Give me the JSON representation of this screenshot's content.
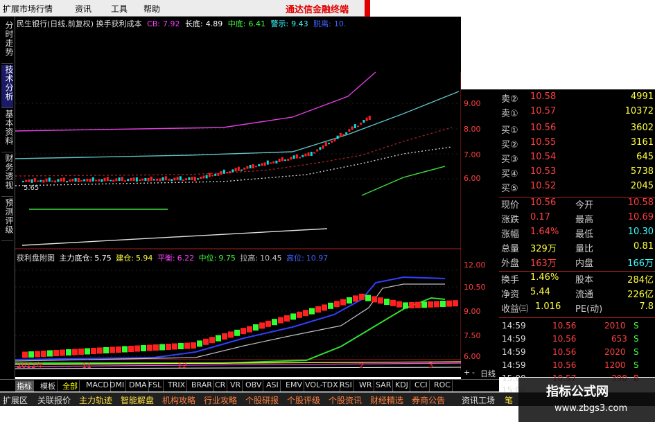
{
  "menubar": {
    "items": [
      "扩展市场行情",
      "资讯",
      "工具",
      "帮助"
    ],
    "brand": "通达信金融终端"
  },
  "left_tabs": [
    "分时走势",
    "技术分析",
    "基本资料",
    "财务透视",
    "预测评级"
  ],
  "main_legend": {
    "title": "民生银行(日线,前复权) 换手获利成本",
    "items": [
      {
        "label": "CB:",
        "value": "7.92",
        "color": "#ff40ff"
      },
      {
        "label": "长底:",
        "value": "4.89",
        "color": "#ffffff"
      },
      {
        "label": "中底:",
        "value": "6.41",
        "color": "#40ff40"
      },
      {
        "label": "警示:",
        "value": "9.43",
        "color": "#40ffff"
      },
      {
        "label": "脱离:",
        "value": "10.",
        "color": "#4060ff"
      }
    ],
    "low_marker": "5.65"
  },
  "sub_legend": {
    "title": "获利盘附图",
    "items": [
      {
        "label": "主力底仓:",
        "value": "5.75",
        "color": "#ffffff"
      },
      {
        "label": "建仓:",
        "value": "5.94",
        "color": "#ffff40"
      },
      {
        "label": "平衡:",
        "value": "6.22",
        "color": "#ff40ff"
      },
      {
        "label": "中位:",
        "value": "9.75",
        "color": "#40ff40"
      },
      {
        "label": "拉高:",
        "value": "10.45",
        "color": "#c0c0c0"
      },
      {
        "label": "高位:",
        "value": "10.97",
        "color": "#4060ff"
      }
    ]
  },
  "price_axis": [
    "9.00",
    "8.00",
    "7.00",
    "6.00",
    "12.00",
    "10.50",
    "9.00",
    "7.50",
    "6.00"
  ],
  "time_axis": [
    "2012年",
    "11",
    "12",
    "2",
    "3"
  ],
  "order_book": [
    {
      "side": "卖②",
      "price": "10.58",
      "vol": "4991"
    },
    {
      "side": "卖①",
      "price": "10.57",
      "vol": "10372"
    },
    {
      "side": "买①",
      "price": "10.56",
      "vol": "3602"
    },
    {
      "side": "买②",
      "price": "10.55",
      "vol": "3161"
    },
    {
      "side": "买③",
      "price": "10.54",
      "vol": "645"
    },
    {
      "side": "买④",
      "price": "10.53",
      "vol": "5738"
    },
    {
      "side": "买⑤",
      "price": "10.52",
      "vol": "2045"
    }
  ],
  "stats": [
    {
      "l1": "现价",
      "v1": "10.56",
      "l2": "今开",
      "v2": "10.58"
    },
    {
      "l1": "涨跌",
      "v1": "0.17",
      "l2": "最高",
      "v2": "10.69"
    },
    {
      "l1": "涨幅",
      "v1": "1.64%",
      "l2": "最低",
      "v2": "10.30"
    },
    {
      "l1": "总量",
      "v1": "329万",
      "l2": "量比",
      "v2": "0.81"
    },
    {
      "l1": "外盘",
      "v1": "163万",
      "l2": "内盘",
      "v2": "166万"
    }
  ],
  "fundamentals": [
    {
      "l1": "换手",
      "v1": "1.46%",
      "l2": "股本",
      "v2": "284亿"
    },
    {
      "l1": "净资",
      "v1": "5.44",
      "l2": "流通",
      "v2": "226亿"
    },
    {
      "l1": "收益㈢",
      "v1": "1.016",
      "l2": "PE(动)",
      "v2": "7.8"
    }
  ],
  "trades": [
    {
      "time": "14:59",
      "price": "10.56",
      "vol": "2010",
      "dir": "S"
    },
    {
      "time": "14:59",
      "price": "10.56",
      "vol": "653",
      "dir": "S"
    },
    {
      "time": "14:59",
      "price": "10.56",
      "vol": "2020",
      "dir": "S"
    },
    {
      "time": "14:59",
      "price": "10.56",
      "vol": "1200",
      "dir": "S"
    },
    {
      "time": "15:00",
      "price": "10.57",
      "vol": "390",
      "dir": "B"
    },
    {
      "time": "15:00",
      "price": "",
      "vol": "",
      "dir": ""
    }
  ],
  "indicator_tabs": [
    "指标",
    "模板",
    "全部",
    "MACD",
    "DMI",
    "DMA",
    "FSL",
    "TRIX",
    "BRAR",
    "CR",
    "VR",
    "OBV",
    "ASI",
    "EMV",
    "VOL-TDX",
    "RSI",
    "WR",
    "SAR",
    "KDJ",
    "CCI",
    "ROC"
  ],
  "period_box": {
    "buttons": [
      "+",
      "-"
    ],
    "label": "日线"
  },
  "nav_tabs": [
    "扩展区",
    "关联报价",
    "主力轨迹",
    "智能解盘",
    "机构攻略",
    "行业攻略",
    "个股研报",
    "个股评级",
    "个股资讯",
    "财经精选",
    "券商公告",
    "资讯工场",
    "笔"
  ],
  "watermark": {
    "title": "指标公式网",
    "url": "www.zbgs3.com"
  },
  "colors": {
    "up": "#ff2020",
    "down": "#00e0e0",
    "bg": "#000000"
  }
}
